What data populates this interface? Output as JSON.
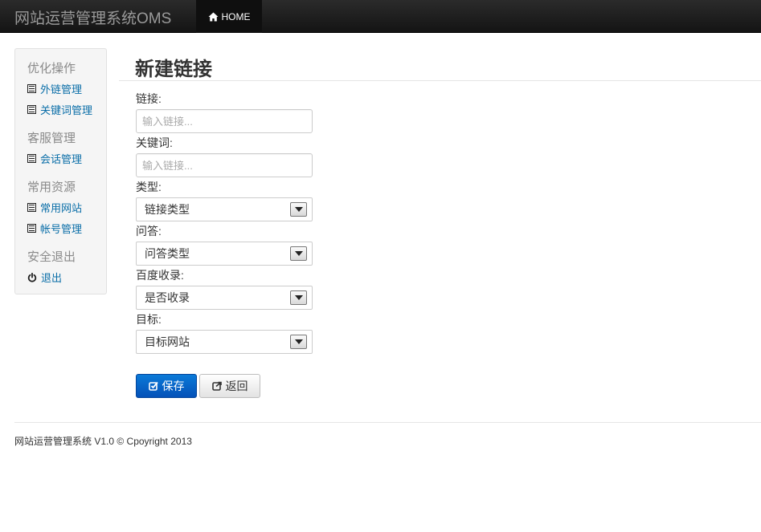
{
  "header": {
    "brand": "网站运营管理系统OMS",
    "home_label": "HOME"
  },
  "sidebar": {
    "sections": [
      {
        "header": "优化操作",
        "items": [
          {
            "label": "外链管理",
            "icon": "list-icon"
          },
          {
            "label": "关键词管理",
            "icon": "list-icon"
          }
        ]
      },
      {
        "header": "客服管理",
        "items": [
          {
            "label": "会话管理",
            "icon": "list-icon"
          }
        ]
      },
      {
        "header": "常用资源",
        "items": [
          {
            "label": "常用网站",
            "icon": "list-icon"
          },
          {
            "label": "帐号管理",
            "icon": "list-icon"
          }
        ]
      },
      {
        "header": "安全退出",
        "items": [
          {
            "label": "退出",
            "icon": "power-icon"
          }
        ]
      }
    ]
  },
  "form": {
    "title": "新建链接",
    "link": {
      "label": "链接:",
      "placeholder": "输入链接...",
      "value": ""
    },
    "keyword": {
      "label": "关键词:",
      "placeholder": "输入链接...",
      "value": ""
    },
    "type": {
      "label": "类型:",
      "selected": "链接类型"
    },
    "qa": {
      "label": "问答:",
      "selected": "问答类型"
    },
    "baidu": {
      "label": "百度收录:",
      "selected": "是否收录"
    },
    "target": {
      "label": "目标:",
      "selected": "目标网站"
    },
    "save_label": "保存",
    "back_label": "返回"
  },
  "footer": {
    "text": "网站运营管理系统 V1.0 © Cpoyright 2013"
  }
}
